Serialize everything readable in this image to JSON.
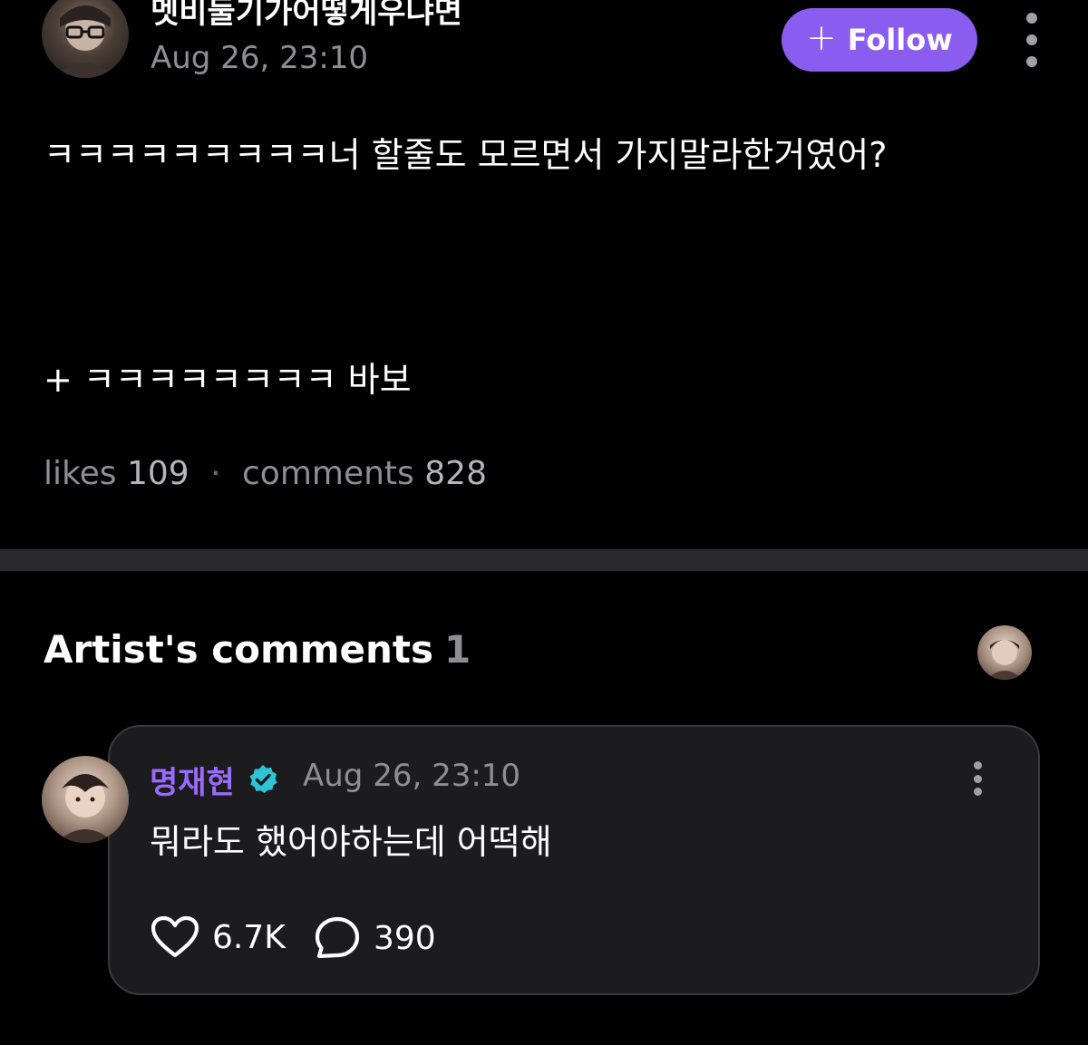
{
  "post": {
    "author_name": "멧비둘기가어떻게우냐면",
    "time": "Aug 26, 23:10",
    "follow_label": "Follow",
    "body_line1": "ㅋㅋㅋㅋㅋㅋㅋㅋㅋ너 할줄도 모르면서 가지말라한거였어?",
    "body_line2": "+ ㅋㅋㅋㅋㅋㅋㅋㅋ 바보",
    "likes_label": "likes",
    "likes_count": "109",
    "separator": "·",
    "comments_label": "comments",
    "comments_count": "828"
  },
  "artist_comments": {
    "heading": "Artist's comments",
    "count": "1",
    "comment": {
      "author": "명재현",
      "time": "Aug 26, 23:10",
      "text": "뭐라도 했어야하는데 어떡해",
      "like_count": "6.7K",
      "reply_count": "390"
    }
  },
  "colors": {
    "background": "#000000",
    "accent_purple": "#8a5cf0",
    "artist_name": "#9b6bff",
    "verified_badge": "#2fc3d6",
    "muted_text": "#8e8e93",
    "card_background": "#1c1c1e"
  },
  "icons": {
    "follow": "plus-icon",
    "more": "vertical-dots-icon",
    "verified": "verified-badge-icon",
    "like": "heart-outline-icon",
    "reply": "speech-bubble-icon"
  }
}
